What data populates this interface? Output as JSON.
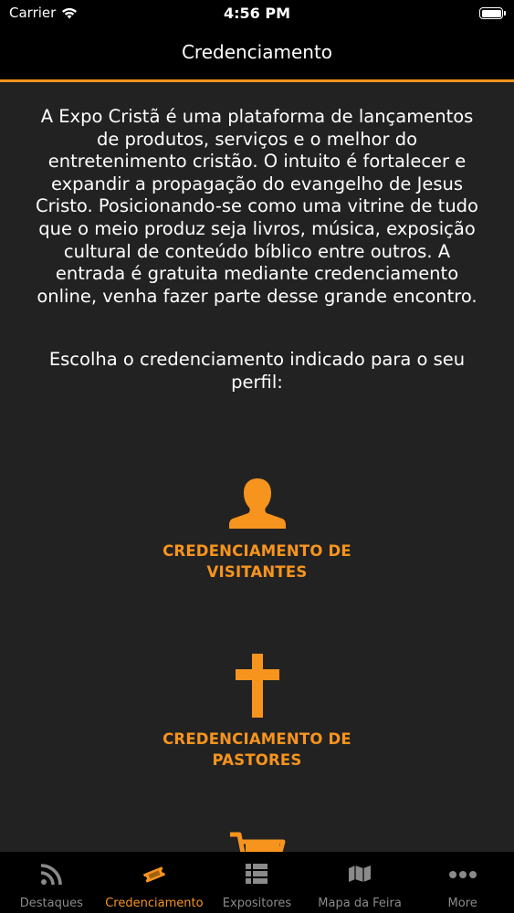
{
  "status_bar": {
    "carrier": "Carrier",
    "time": "4:56 PM"
  },
  "nav": {
    "title": "Credenciamento"
  },
  "intro_text": "A Expo Cristã é uma plataforma de lançamentos de produtos, serviços e o melhor do entretenimento cristão. O intuito é fortalecer e expandir a propagação do evangelho de Jesus Cristo. Posicionando-se como uma vitrine de tudo que o meio produz seja livros, música, exposição cultural de conteúdo bíblico entre outros. A entrada é gratuita mediante credenciamento online, venha fazer parte desse grande encontro.",
  "choose_text": "Escolha o credenciamento indicado para o seu perfil:",
  "options": [
    {
      "icon": "person-icon",
      "line1": "CREDENCIAMENTO DE",
      "line2": "VISITANTES"
    },
    {
      "icon": "cross-icon",
      "line1": "CREDENCIAMENTO DE",
      "line2": "PASTORES"
    },
    {
      "icon": "cart-icon"
    }
  ],
  "tabs": [
    {
      "label": "Destaques",
      "icon": "rss-icon",
      "active": false
    },
    {
      "label": "Credenciamento",
      "icon": "ticket-icon",
      "active": true
    },
    {
      "label": "Expositores",
      "icon": "list-icon",
      "active": false
    },
    {
      "label": "Mapa da Feira",
      "icon": "map-icon",
      "active": false
    },
    {
      "label": "More",
      "icon": "more-icon",
      "active": false
    }
  ],
  "colors": {
    "accent": "#f7941d",
    "background": "#222222",
    "bar": "#000000",
    "inactive_tab": "#8a8a8a"
  }
}
